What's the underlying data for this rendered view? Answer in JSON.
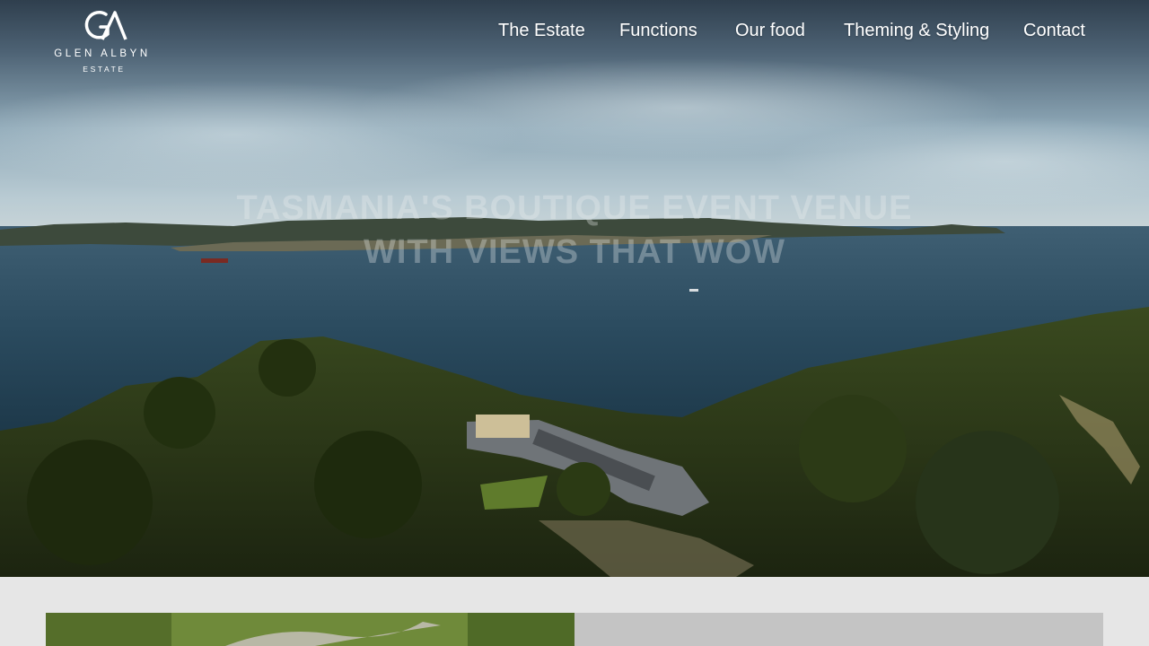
{
  "brand": {
    "name": "GLEN ALBYN",
    "sub": "ESTATE",
    "logo_icon": "ga-monogram-icon"
  },
  "nav": {
    "items": [
      {
        "label": "The Estate"
      },
      {
        "label": "Functions"
      },
      {
        "label": "Our food"
      },
      {
        "label": "Theming & Styling"
      },
      {
        "label": "Contact"
      }
    ]
  },
  "hero": {
    "headline": "Tasmania's boutique event venue with views that wow"
  },
  "colors": {
    "nav_text": "#ffffff",
    "page_background": "#e6e6e6",
    "panel_grey": "#c4c4c4"
  }
}
